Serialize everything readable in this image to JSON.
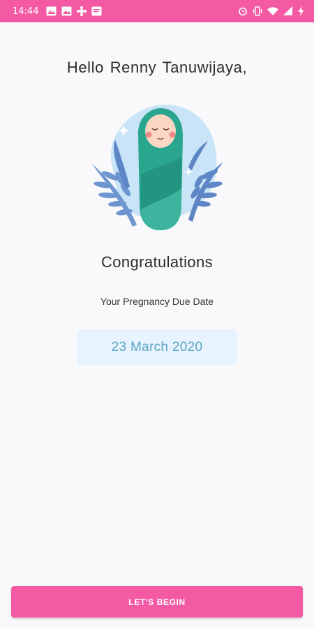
{
  "status_bar": {
    "time": "14:44",
    "background_color": "#f35aa3",
    "left_icons": [
      "gallery-icon",
      "gallery-icon",
      "app-notification-icon",
      "message-icon"
    ],
    "right_icons": [
      "alarm-icon",
      "vibrate-icon",
      "wifi-icon",
      "signal-icon",
      "battery-charging-icon"
    ]
  },
  "greeting": {
    "text": "Hello Renny Tanuwijaya,"
  },
  "illustration": {
    "name": "swaddled-baby-illustration"
  },
  "congrats": {
    "title": "Congratulations"
  },
  "due_date": {
    "label": "Your Pregnancy Due Date",
    "value": "23 March 2020",
    "box_color": "#e7f3fe",
    "text_color": "#58a3c4"
  },
  "actions": {
    "begin_label": "LET'S BEGIN",
    "accent_color": "#f35aa3"
  }
}
